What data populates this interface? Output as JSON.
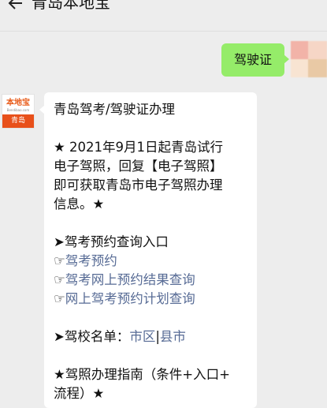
{
  "header": {
    "title": "青岛本地宝"
  },
  "outgoing": {
    "text": "驾驶证"
  },
  "bot_avatar": {
    "brand": "本地宝",
    "sub": "Bendibao.com",
    "city": "青岛"
  },
  "incoming": {
    "heading": "青岛驾考/驾驶证办理",
    "notice_lines": [
      "★ 2021年9月1日起青岛试行",
      "电子驾照，回复【电子驾照】",
      "即可获取青岛市电子驾照办理",
      "信息。★"
    ],
    "section1_title": "➤驾考预约查询入口",
    "hand_glyph": "☞",
    "link1": "驾考预约",
    "link2": "驾考网上预约结果查询",
    "link3": "网上驾考预约计划查询",
    "school_label": "➤驾校名单：",
    "school_link1": "市区",
    "school_sep": "|",
    "school_link2": "县市",
    "guide_line1": "★驾照办理指南（条件+入口+",
    "guide_line2": "流程）★"
  }
}
